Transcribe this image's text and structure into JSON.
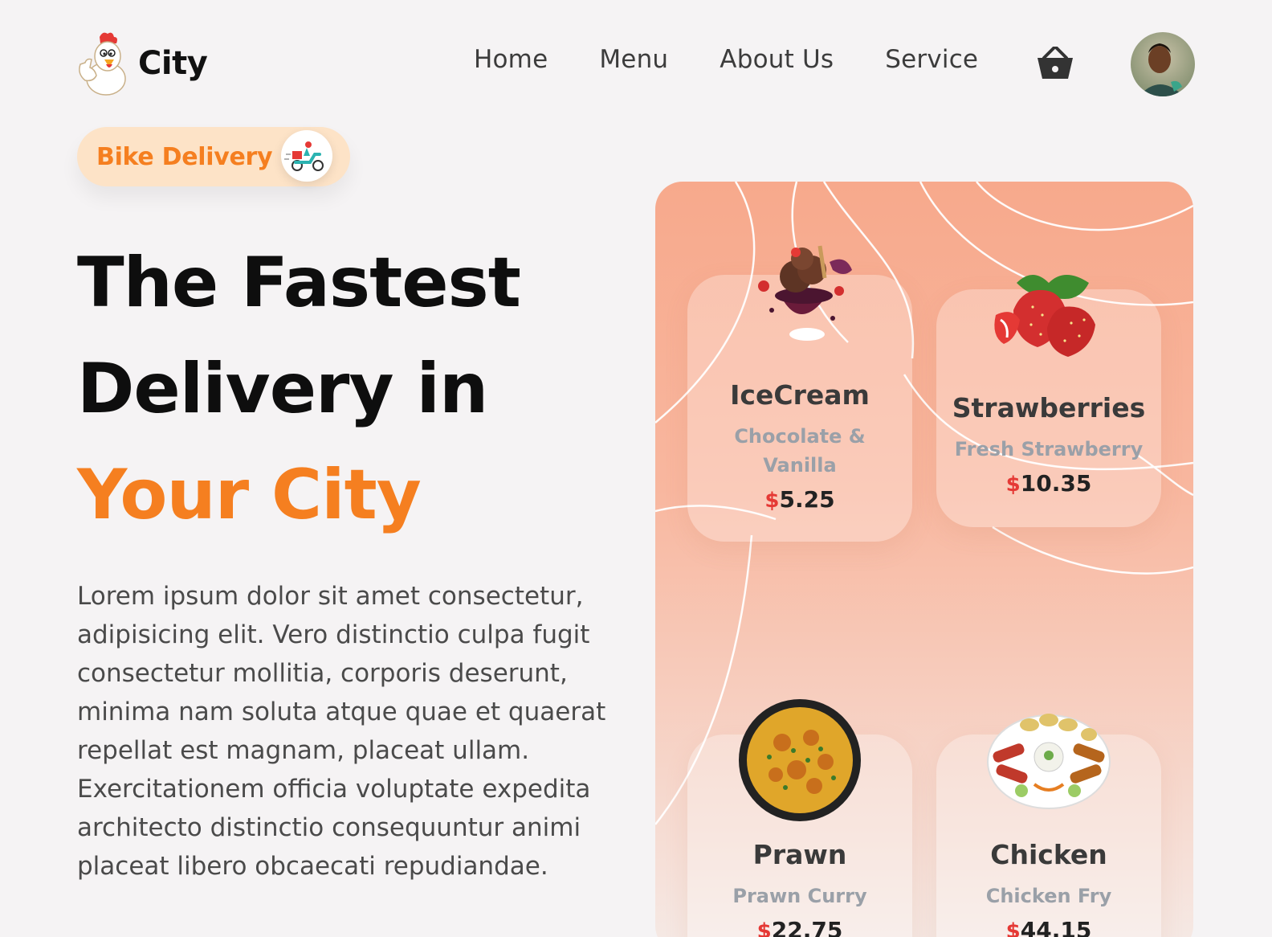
{
  "brand": {
    "name": "City"
  },
  "nav": {
    "items": [
      "Home",
      "Menu",
      "About Us",
      "Service"
    ]
  },
  "icons": {
    "cart": "cart-icon",
    "avatar": "user-avatar",
    "delivery": "scooter-icon",
    "logo": "chicken-mascot-logo"
  },
  "badge": {
    "label": "Bike Delivery"
  },
  "hero": {
    "line1": "The Fastest",
    "line2": "Delivery in",
    "line3": "Your City"
  },
  "description": "Lorem ipsum dolor sit amet consectetur, adipisicing elit. Vero distinctio culpa fugit consectetur mollitia, corporis deserunt, minima nam soluta atque quae et quaerat repellat est magnam, placeat ullam. Exercitationem officia voluptate expedita architecto distinctio consequuntur animi placeat libero obcaecati repudiandae.",
  "currency": "$",
  "products": [
    {
      "name": "IceCream",
      "description": "Chocolate & Vanilla",
      "price": "5.25"
    },
    {
      "name": "Strawberries",
      "description": "Fresh Strawberry",
      "price": "10.35"
    },
    {
      "name": "Prawn",
      "description": "Prawn Curry",
      "price": "22.75"
    },
    {
      "name": "Chicken",
      "description": "Chicken Fry",
      "price": "44.15"
    }
  ],
  "colors": {
    "accent": "#f57f20",
    "price_symbol": "#e53935",
    "background": "#f5f3f4"
  }
}
